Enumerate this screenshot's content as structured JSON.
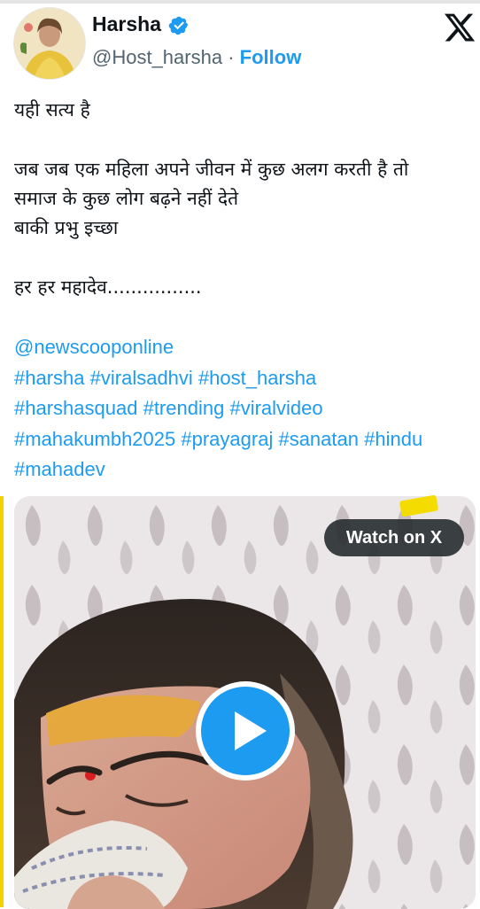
{
  "author": {
    "name": "Harsha",
    "handle": "@Host_harsha",
    "separator": "·",
    "follow_label": "Follow"
  },
  "post": {
    "lines": [
      "यही सत्य है",
      "",
      "जब जब एक महिला अपने जीवन में कुछ अलग करती है तो",
      "समाज के कुछ लोग बढ़ने नहीं देते",
      "बाकी प्रभु इच्छा",
      "",
      "हर हर महादेव................"
    ],
    "tags": [
      [
        "@newscooponline"
      ],
      [
        "#harsha",
        "#viralsadhvi",
        "#host_harsha"
      ],
      [
        "#harshasquad",
        "#trending",
        "#viralvideo"
      ],
      [
        "#mahakumbh2025",
        "#prayagraj",
        "#sanatan",
        "#hindu"
      ],
      [
        "#mahadev"
      ]
    ]
  },
  "media": {
    "watch_label": "Watch on X"
  },
  "colors": {
    "accent": "#1d9bf0",
    "text": "#0f1419",
    "secondary": "#536471"
  },
  "icons": {
    "verified": "verified-badge-icon",
    "logo": "x-logo-icon",
    "play": "play-icon"
  }
}
